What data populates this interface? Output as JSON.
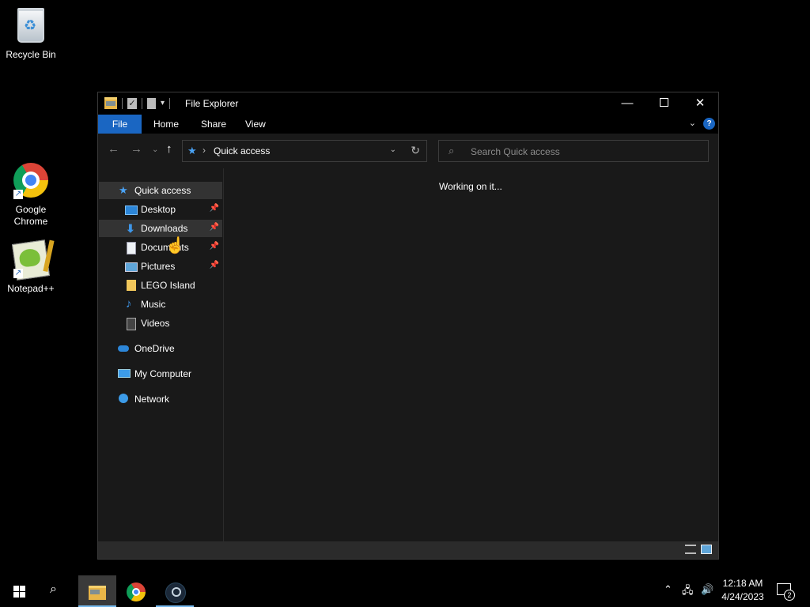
{
  "desktop": {
    "icons": [
      {
        "label": "Recycle Bin"
      },
      {
        "label": "Google\nChrome"
      },
      {
        "label": "Notepad++"
      }
    ]
  },
  "window": {
    "title": "File Explorer",
    "ribbon_tabs": [
      "File",
      "Home",
      "Share",
      "View"
    ],
    "address": {
      "path": "Quick access"
    },
    "search": {
      "placeholder": "Search Quick access"
    },
    "nav_items": [
      {
        "label": "Quick access",
        "icon": "star-icon",
        "pinned": false
      },
      {
        "label": "Desktop",
        "icon": "desktop-icon",
        "pinned": true
      },
      {
        "label": "Downloads",
        "icon": "download-icon",
        "pinned": true
      },
      {
        "label": "Documents",
        "icon": "documents-icon",
        "pinned": true
      },
      {
        "label": "Pictures",
        "icon": "pictures-icon",
        "pinned": true
      },
      {
        "label": "LEGO Island",
        "icon": "folder-icon",
        "pinned": false
      },
      {
        "label": "Music",
        "icon": "music-icon",
        "pinned": false
      },
      {
        "label": "Videos",
        "icon": "videos-icon",
        "pinned": false
      },
      {
        "label": "OneDrive",
        "icon": "cloud-icon",
        "pinned": false
      },
      {
        "label": "My Computer",
        "icon": "computer-icon",
        "pinned": false
      },
      {
        "label": "Network",
        "icon": "network-icon",
        "pinned": false
      }
    ],
    "content_status": "Working on it..."
  },
  "taskbar": {
    "time": "12:18 AM",
    "date": "4/24/2023",
    "notification_count": "2"
  },
  "colors": {
    "accent": "#1a66c2",
    "window_bg": "#191919",
    "taskbar_bg": "#000000"
  }
}
